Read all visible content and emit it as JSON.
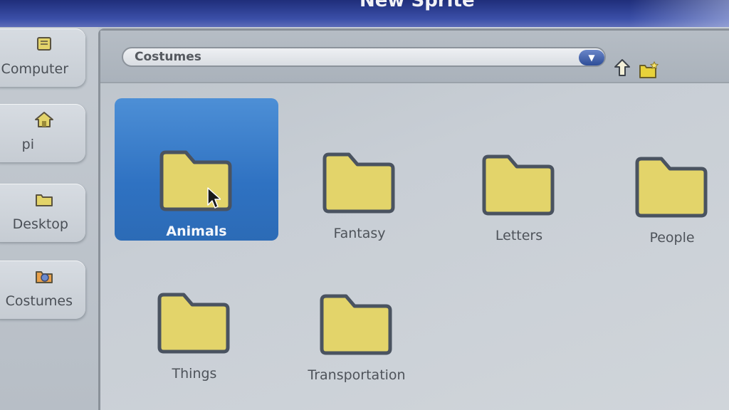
{
  "window": {
    "title": "New Sprite"
  },
  "sidebar": {
    "items": [
      {
        "label": "Computer",
        "icon": "computer-icon"
      },
      {
        "label": "pi",
        "icon": "home-icon"
      },
      {
        "label": "Desktop",
        "icon": "folder-icon"
      },
      {
        "label": "Costumes",
        "icon": "costumes-icon"
      }
    ]
  },
  "pathbar": {
    "current_path": "Costumes",
    "dropdown_icon": "chevron-down-icon",
    "up_icon": "up-arrow-icon",
    "new_folder_icon": "new-folder-icon"
  },
  "folders": [
    {
      "label": "Animals",
      "selected": true
    },
    {
      "label": "Fantasy",
      "selected": false
    },
    {
      "label": "Letters",
      "selected": false
    },
    {
      "label": "People",
      "selected": false
    },
    {
      "label": "Things",
      "selected": false
    },
    {
      "label": "Transportation",
      "selected": false
    }
  ],
  "colors": {
    "selection": "#2f72c2",
    "folder_fill": "#e3d46a",
    "folder_outline": "#4a5360",
    "titlebar": "#2a3a8c"
  }
}
